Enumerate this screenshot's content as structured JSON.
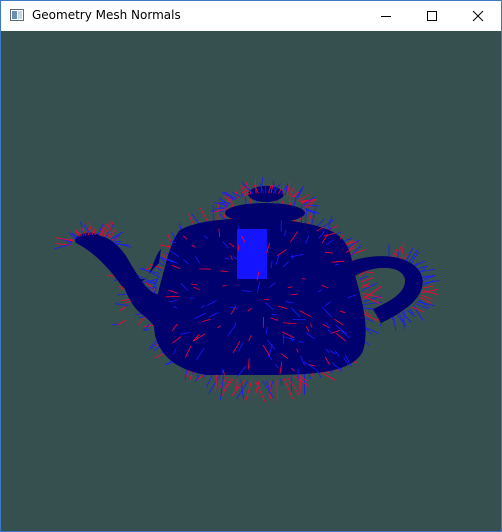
{
  "window": {
    "title": "Geometry Mesh Normals",
    "controls": {
      "minimize_icon": "minimize-icon",
      "maximize_icon": "maximize-icon",
      "close_icon": "close-icon"
    }
  },
  "scene": {
    "object": "teapot-icon",
    "background_color": "#364f4f",
    "mesh_color": "#00006e",
    "highlight_color": "#1414ff",
    "normal_colors": [
      "#ff0033",
      "#1a1aff"
    ]
  }
}
